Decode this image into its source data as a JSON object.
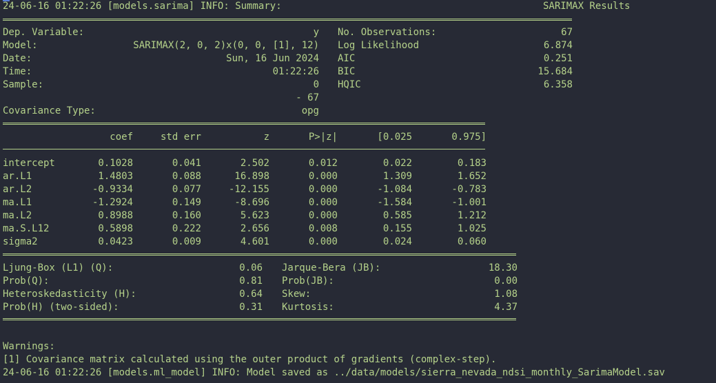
{
  "log_start": {
    "timestamp": "24-06-16 01:22:26",
    "logger": "[models.sarima]",
    "level": "INFO:",
    "message": "Summary:",
    "results_title": "SARIMAX Results"
  },
  "header_table": {
    "left": [
      {
        "label": "Dep. Variable:",
        "value": "y"
      },
      {
        "label": "Model:",
        "value": "SARIMAX(2, 0, 2)x(0, 0, [1], 12)"
      },
      {
        "label": "Date:",
        "value": "Sun, 16 Jun 2024"
      },
      {
        "label": "Time:",
        "value": "01:22:26"
      },
      {
        "label": "Sample:",
        "value": "0"
      },
      {
        "label": "",
        "value": "- 67"
      },
      {
        "label": "Covariance Type:",
        "value": "opg"
      }
    ],
    "right": [
      {
        "label": "No. Observations:",
        "value": "67"
      },
      {
        "label": "Log Likelihood",
        "value": "6.874"
      },
      {
        "label": "AIC",
        "value": "0.251"
      },
      {
        "label": "BIC",
        "value": "15.684"
      },
      {
        "label": "HQIC",
        "value": "6.358"
      }
    ]
  },
  "coef_table": {
    "columns": [
      "coef",
      "std err",
      "z",
      "P>|z|",
      "[0.025",
      "0.975]"
    ],
    "rows": [
      {
        "name": "intercept",
        "values": [
          "0.1028",
          "0.041",
          "2.502",
          "0.012",
          "0.022",
          "0.183"
        ]
      },
      {
        "name": "ar.L1",
        "values": [
          "1.4803",
          "0.088",
          "16.898",
          "0.000",
          "1.309",
          "1.652"
        ]
      },
      {
        "name": "ar.L2",
        "values": [
          "-0.9334",
          "0.077",
          "-12.155",
          "0.000",
          "-1.084",
          "-0.783"
        ]
      },
      {
        "name": "ma.L1",
        "values": [
          "-1.2924",
          "0.149",
          "-8.696",
          "0.000",
          "-1.584",
          "-1.001"
        ]
      },
      {
        "name": "ma.L2",
        "values": [
          "0.8988",
          "0.160",
          "5.623",
          "0.000",
          "0.585",
          "1.212"
        ]
      },
      {
        "name": "ma.S.L12",
        "values": [
          "0.5898",
          "0.222",
          "2.656",
          "0.008",
          "0.155",
          "1.025"
        ]
      },
      {
        "name": "sigma2",
        "values": [
          "0.0423",
          "0.009",
          "4.601",
          "0.000",
          "0.024",
          "0.060"
        ]
      }
    ]
  },
  "diagnostics": {
    "rows": [
      {
        "l_label": "Ljung-Box (L1) (Q):",
        "l_value": "0.06",
        "r_label": "Jarque-Bera (JB):",
        "r_value": "18.30"
      },
      {
        "l_label": "Prob(Q):",
        "l_value": "0.81",
        "r_label": "Prob(JB):",
        "r_value": "0.00"
      },
      {
        "l_label": "Heteroskedasticity (H):",
        "l_value": "0.64",
        "r_label": "Skew:",
        "r_value": "1.08"
      },
      {
        "l_label": "Prob(H) (two-sided):",
        "l_value": "0.31",
        "r_label": "Kurtosis:",
        "r_value": "4.37"
      }
    ]
  },
  "warnings": {
    "title": "Warnings:",
    "items": [
      "[1] Covariance matrix calculated using the outer product of gradients (complex-step)."
    ]
  },
  "log_end": {
    "timestamp": "24-06-16 01:22:26",
    "logger": "[models.ml_model]",
    "level": "INFO:",
    "message": "Model saved as ../data/models/sierra_nevada_ndsi_monthly_SarimaModel.sav"
  },
  "colors": {
    "background": "#272a35",
    "text": "#b5d28a",
    "cursor": "#5a7fd6"
  }
}
